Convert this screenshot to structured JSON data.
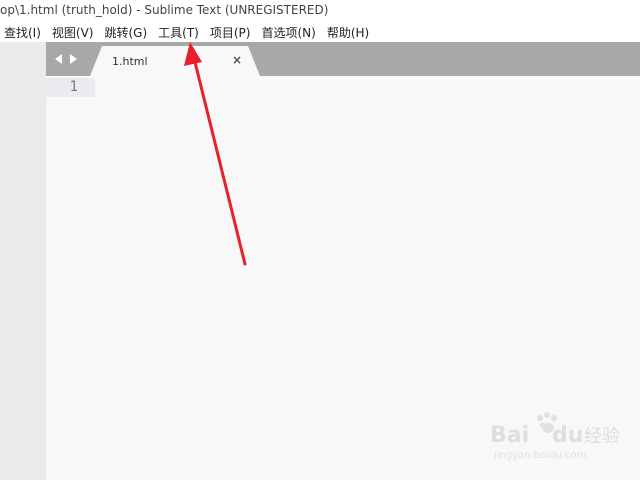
{
  "window": {
    "title": "op\\1.html (truth_hold) - Sublime Text (UNREGISTERED)"
  },
  "menubar": {
    "items": [
      {
        "label": "查找(I)"
      },
      {
        "label": "视图(V)"
      },
      {
        "label": "跳转(G)"
      },
      {
        "label": "工具(T)"
      },
      {
        "label": "项目(P)"
      },
      {
        "label": "首选项(N)"
      },
      {
        "label": "帮助(H)"
      }
    ]
  },
  "tabs": {
    "nav_back_icon": "triangle-left-icon",
    "nav_forward_icon": "triangle-right-icon",
    "active": {
      "label": "1.html",
      "close_glyph": "×"
    }
  },
  "editor": {
    "line_numbers": [
      "1"
    ],
    "lines": [
      ""
    ]
  },
  "annotation": {
    "color": "#e8202a",
    "target": "menu-item-tools"
  },
  "watermark": {
    "brand": "Baidu 经验",
    "url": "jingyan.baidu.com"
  },
  "colors": {
    "tabbar": "#a8a8a8",
    "sidebar": "#e8eaec",
    "editor_bg": "#f8f8f8",
    "tab_bg": "#f8f8f8"
  }
}
